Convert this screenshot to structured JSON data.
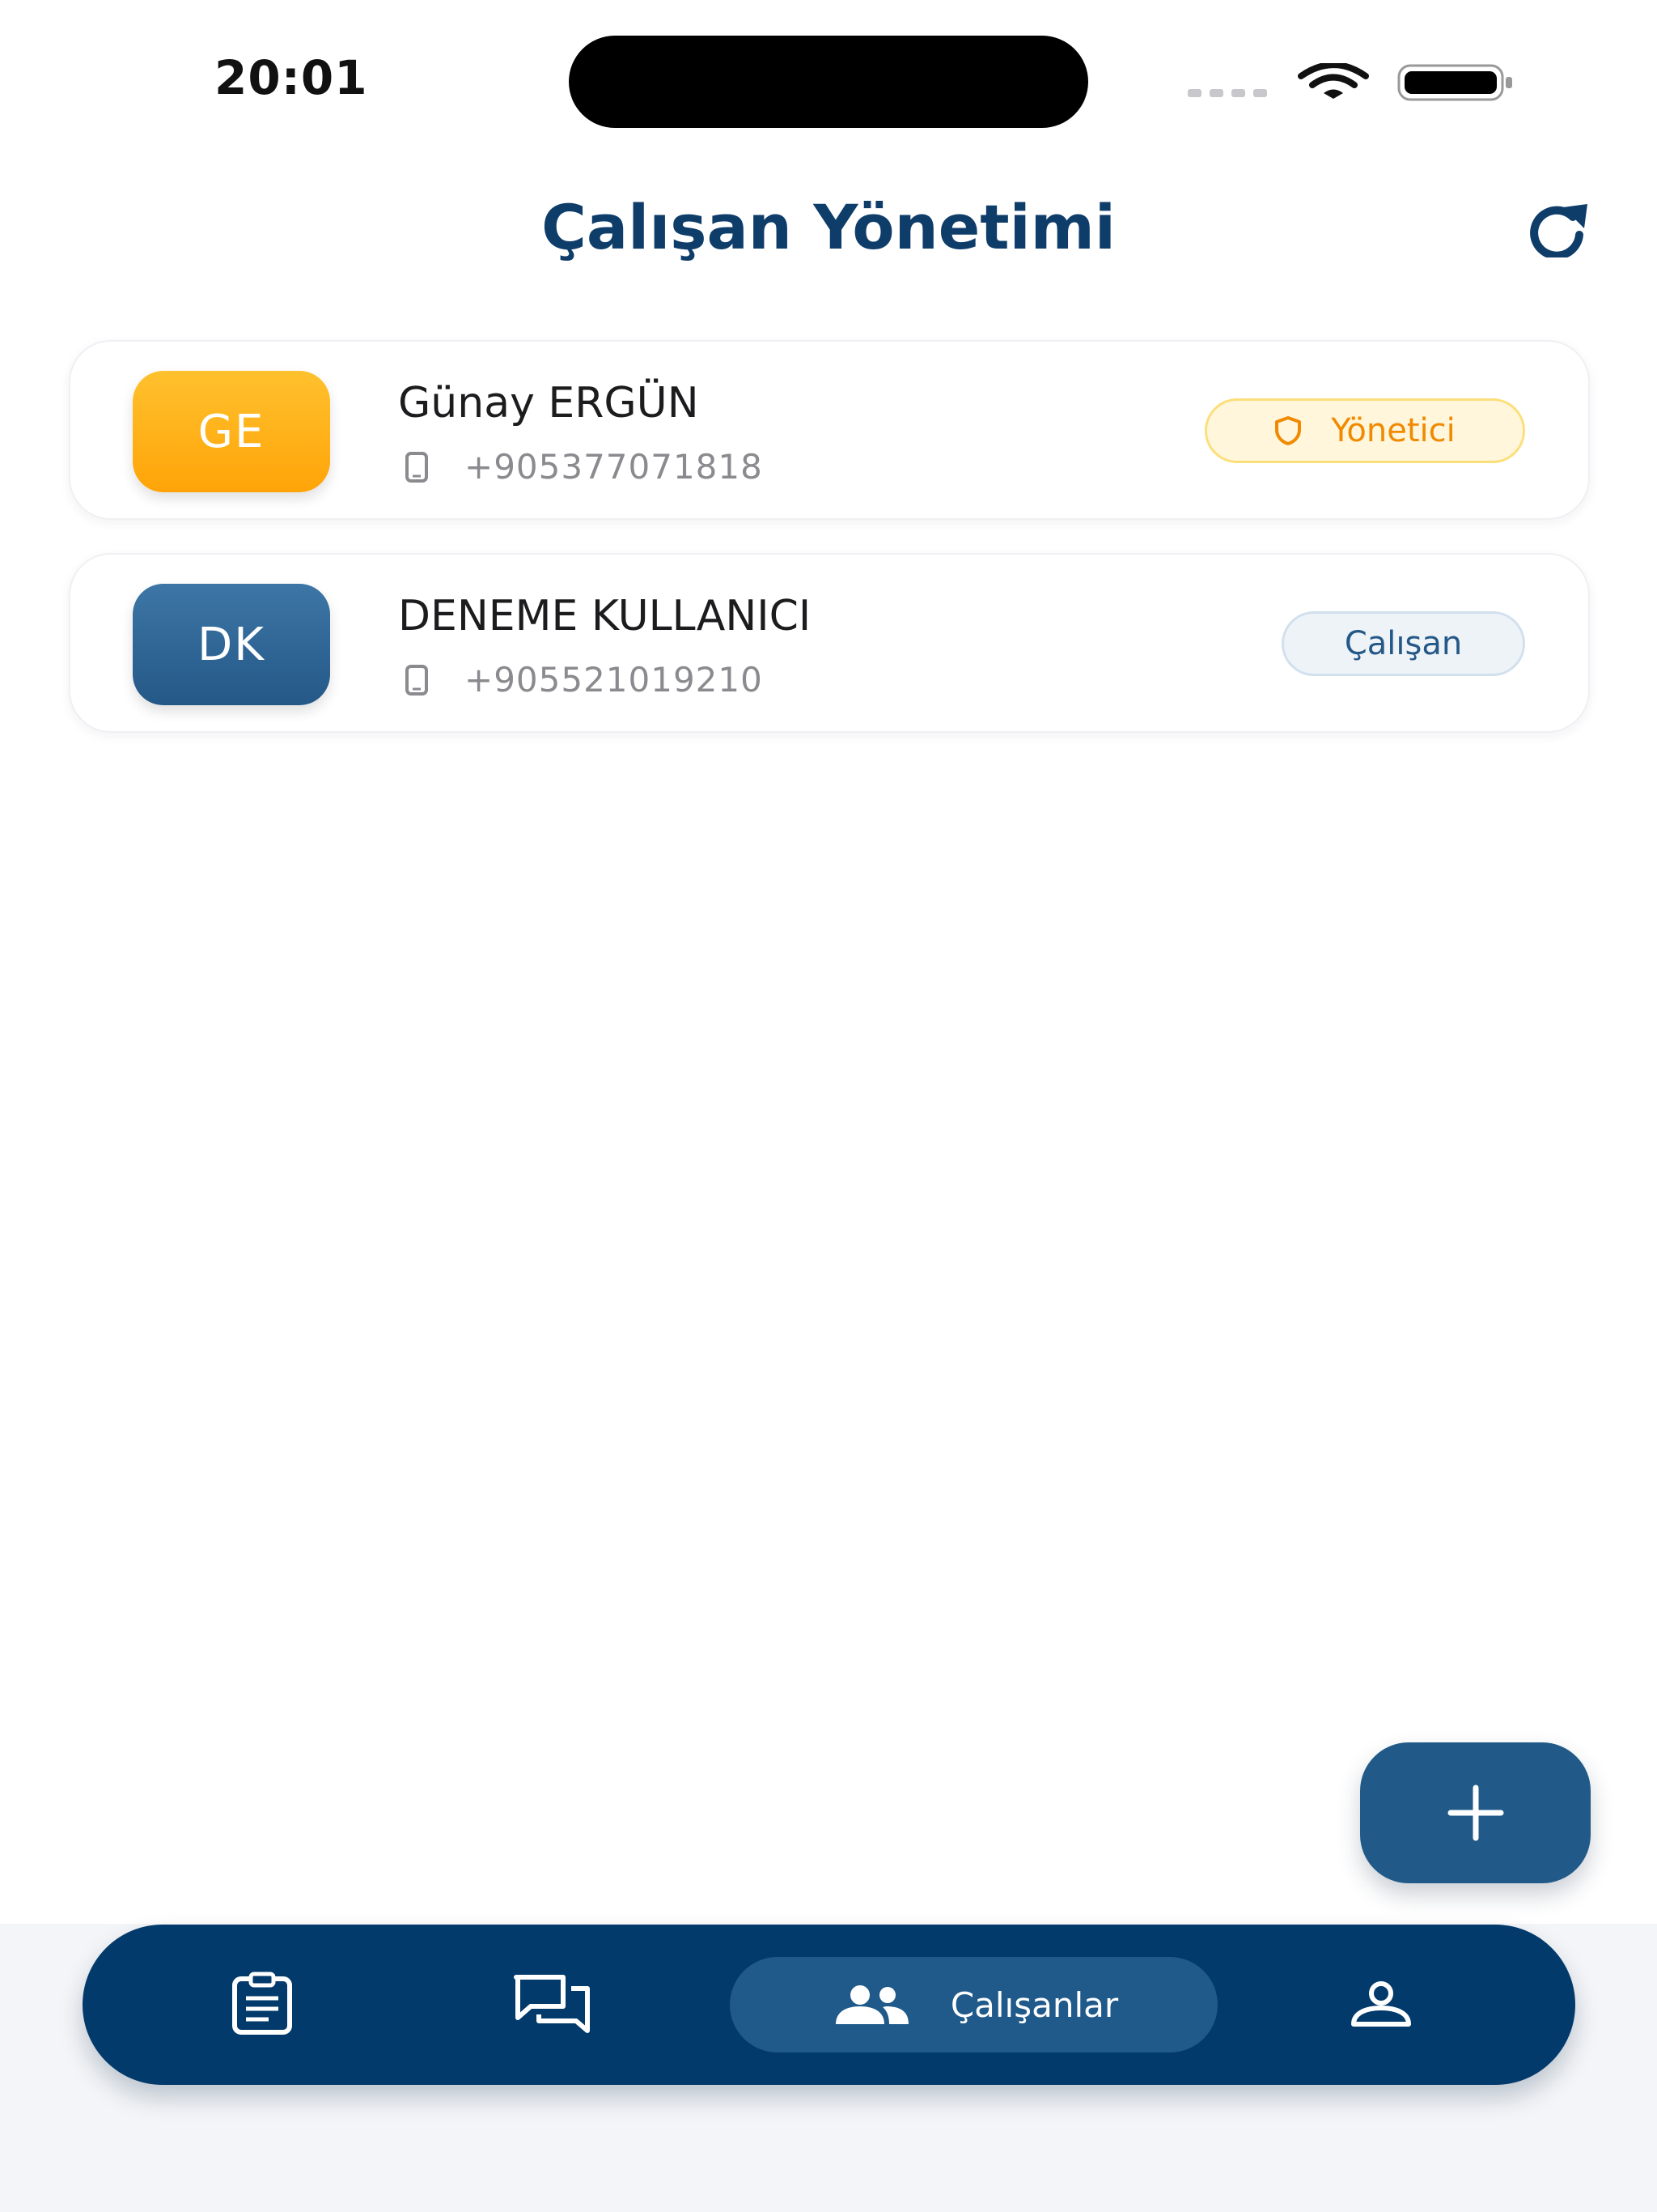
{
  "status_bar": {
    "time": "20:01"
  },
  "header": {
    "title": "Çalışan Yönetimi",
    "refresh_icon": "refresh-icon"
  },
  "employees": [
    {
      "initials": "GE",
      "name": "Günay ERGÜN",
      "phone": "+905377071818",
      "role": "Yönetici",
      "avatar_color": "#ffb31a",
      "role_color": "#f08a00"
    },
    {
      "initials": "DK",
      "name": "DENEME KULLANICI",
      "phone": "+905521019210",
      "role": "Çalışan",
      "avatar_color": "#2f6798",
      "role_color": "#245887"
    }
  ],
  "fab": {
    "icon": "plus-icon"
  },
  "tab_bar": {
    "items": [
      {
        "icon": "clipboard-icon",
        "label": ""
      },
      {
        "icon": "chat-icon",
        "label": ""
      },
      {
        "icon": "people-icon",
        "label": "Çalışanlar",
        "active": true
      },
      {
        "icon": "person-icon",
        "label": ""
      }
    ]
  },
  "colors": {
    "primary": "#023a6b",
    "title": "#0f3d6a",
    "accent_active_tab": "#1f5a8a",
    "background": "#ffffff"
  }
}
